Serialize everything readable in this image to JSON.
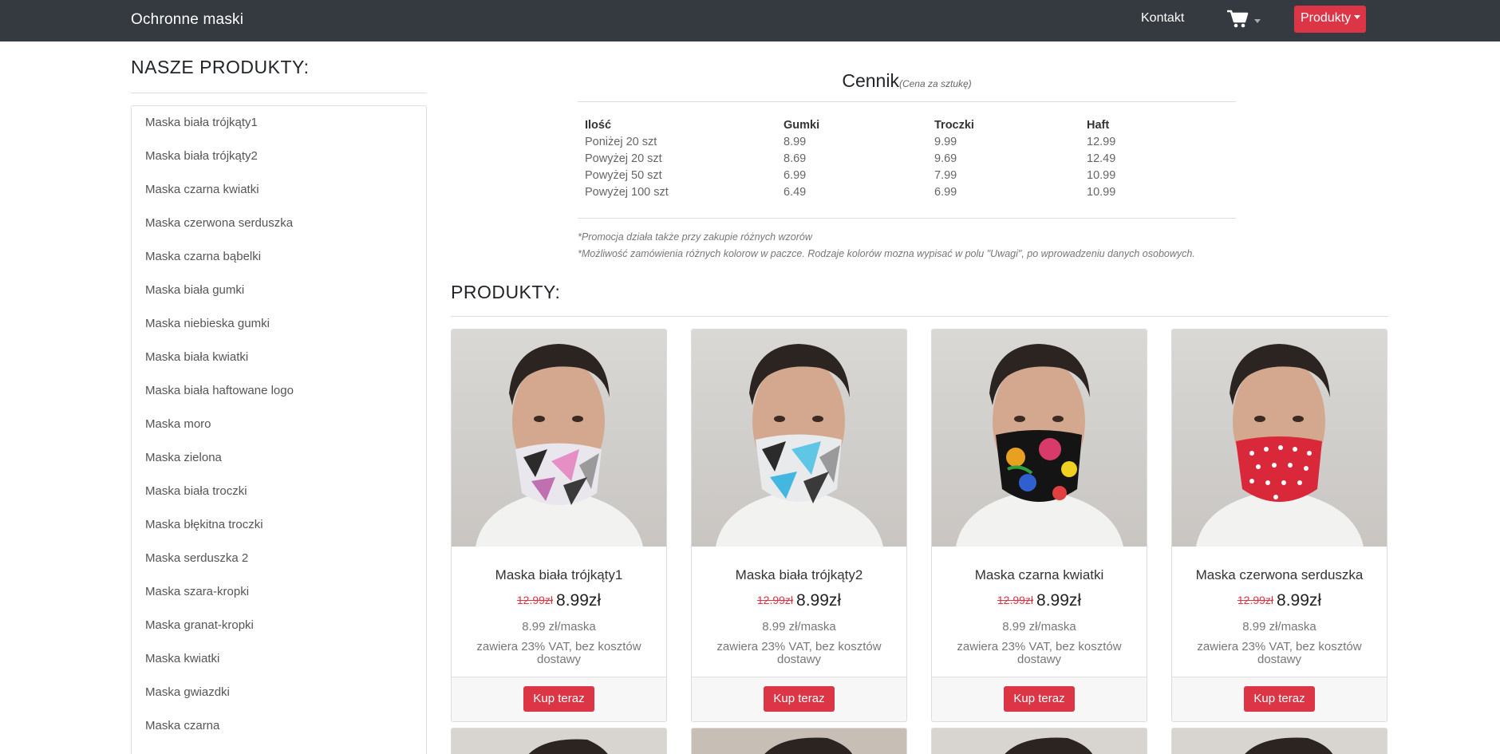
{
  "navbar": {
    "brand": "Ochronne maski",
    "contact": "Kontakt",
    "products_dropdown": "Produkty",
    "cart_icon": "shopping-cart-icon"
  },
  "sidebar": {
    "title": "NASZE PRODUKTY:",
    "items": [
      "Maska biała trójkąty1",
      "Maska biała trójkąty2",
      "Maska czarna kwiatki",
      "Maska czerwona serduszka",
      "Maska czarna bąbelki",
      "Maska biała gumki",
      "Maska niebieska gumki",
      "Maska biała kwiatki",
      "Maska biała haftowane logo",
      "Maska moro",
      "Maska zielona",
      "Maska biała troczki",
      "Maska błękitna troczki",
      "Maska serduszka 2",
      "Maska szara-kropki",
      "Maska granat-kropki",
      "Maska kwiatki",
      "Maska gwiazdki",
      "Maska czarna"
    ]
  },
  "pricing": {
    "title": "Cennik",
    "subtitle": "(Cena za sztukę)",
    "headers": [
      "Ilość",
      "Gumki",
      "Troczki",
      "Haft"
    ],
    "rows": [
      [
        "Poniżej 20 szt",
        "8.99",
        "9.99",
        "12.99"
      ],
      [
        "Powyżej 20 szt",
        "8.69",
        "9.69",
        "12.49"
      ],
      [
        "Powyżej 50 szt",
        "6.99",
        "7.99",
        "10.99"
      ],
      [
        "Powyżej 100 szt",
        "6.49",
        "6.99",
        "10.99"
      ]
    ],
    "note1": "*Promocja działa także przy zakupie różnych wzorów",
    "note2": "*Możliwość zamówienia różnych kolorow w paczce. Rodzaje kolorów mozna wypisać w polu \"Uwagi\", po wprowadzeniu danych osobowych."
  },
  "products": {
    "title": "PRODUKTY:",
    "cards": [
      {
        "name": "Maska biała trójkąty1",
        "old_price": "12.99zł",
        "price": "8.99zł",
        "unit": "8.99 zł/maska",
        "vat": "zawiera 23% VAT, bez kosztów dostawy",
        "button": "Kup teraz"
      },
      {
        "name": "Maska biała trójkąty2",
        "old_price": "12.99zł",
        "price": "8.99zł",
        "unit": "8.99 zł/maska",
        "vat": "zawiera 23% VAT, bez kosztów dostawy",
        "button": "Kup teraz"
      },
      {
        "name": "Maska czarna kwiatki",
        "old_price": "12.99zł",
        "price": "8.99zł",
        "unit": "8.99 zł/maska",
        "vat": "zawiera 23% VAT, bez kosztów dostawy",
        "button": "Kup teraz"
      },
      {
        "name": "Maska czerwona serduszka",
        "old_price": "12.99zł",
        "price": "8.99zł",
        "unit": "8.99 zł/maska",
        "vat": "zawiera 23% VAT, bez kosztów dostawy",
        "button": "Kup teraz"
      }
    ]
  },
  "colors": {
    "navbar_bg": "#343a40",
    "accent_red": "#dc3545"
  }
}
